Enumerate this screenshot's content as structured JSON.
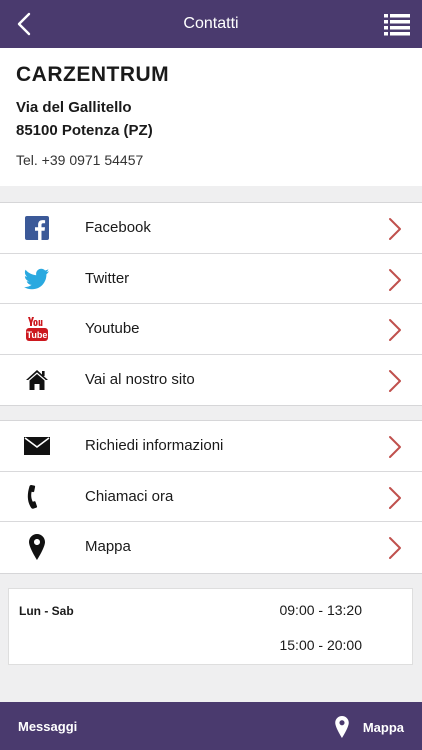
{
  "header": {
    "title": "Contatti"
  },
  "company": {
    "name": "CARZENTRUM",
    "address_line1": "Via del Gallitello",
    "address_line2": "85100 Potenza (PZ)",
    "phone": "Tel. +39 0971 54457"
  },
  "social": {
    "items": [
      {
        "label": "Facebook",
        "icon": "facebook-icon"
      },
      {
        "label": "Twitter",
        "icon": "twitter-icon"
      },
      {
        "label": "Youtube",
        "icon": "youtube-icon"
      },
      {
        "label": "Vai al nostro sito",
        "icon": "home-icon"
      }
    ]
  },
  "contact": {
    "items": [
      {
        "label": "Richiedi informazioni",
        "icon": "envelope-icon"
      },
      {
        "label": "Chiamaci ora",
        "icon": "phone-icon"
      },
      {
        "label": "Mappa",
        "icon": "map-pin-icon"
      }
    ]
  },
  "hours": {
    "day": "Lun - Sab",
    "morning": "09:00 - 13:20",
    "afternoon": "15:00 - 20:00"
  },
  "footer": {
    "messages_label": "Messaggi",
    "map_label": "Mappa"
  },
  "colors": {
    "bar": "#4a3a6e",
    "chevron": "#c0504d",
    "facebook": "#3b5998",
    "twitter": "#2aa9e0",
    "youtube": "#cc181e"
  }
}
